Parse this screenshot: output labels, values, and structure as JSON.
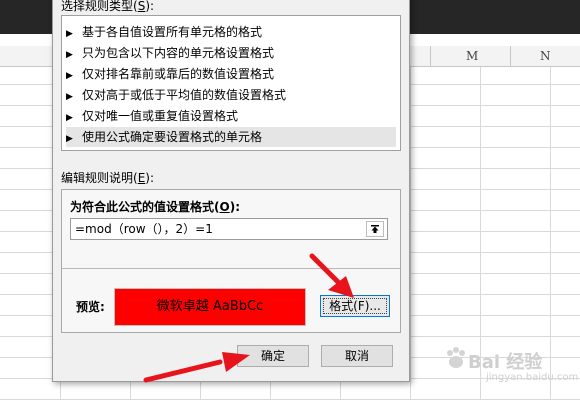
{
  "sheet": {
    "columns": [
      {
        "letter": "M"
      },
      {
        "letter": "N"
      }
    ]
  },
  "dialog": {
    "rule_type_label": "选择规则类型(",
    "rule_type_hotkey": "S",
    "rule_type_suffix": "):",
    "rule_types": [
      {
        "label": "基于各自值设置所有单元格的格式",
        "selected": false
      },
      {
        "label": "只为包含以下内容的单元格设置格式",
        "selected": false
      },
      {
        "label": "仅对排名靠前或靠后的数值设置格式",
        "selected": false
      },
      {
        "label": "仅对高于或低于平均值的数值设置格式",
        "selected": false
      },
      {
        "label": "仅对唯一值或重复值设置格式",
        "selected": false
      },
      {
        "label": "使用公式确定要设置格式的单元格",
        "selected": true
      }
    ],
    "bullet": "▶",
    "edit_desc_label": "编辑规则说明(",
    "edit_desc_hotkey": "E",
    "edit_desc_suffix": "):",
    "formula_label": "为符合此公式的值设置格式(",
    "formula_hotkey": "O",
    "formula_suffix": "):",
    "formula_value": "=mod（row（），2）=1",
    "preview_label": "预览:",
    "preview_text": "微软卓越  AaBbCc",
    "preview_bg": "#ff0000",
    "format_button": "格式(F)...",
    "ok_button": "确定",
    "cancel_button": "取消"
  },
  "watermark": {
    "text": "Bai 经验",
    "url": "jingyan.baidu.com"
  },
  "colors": {
    "arrow": "#e8141c",
    "focus_border": "#0078d7"
  }
}
